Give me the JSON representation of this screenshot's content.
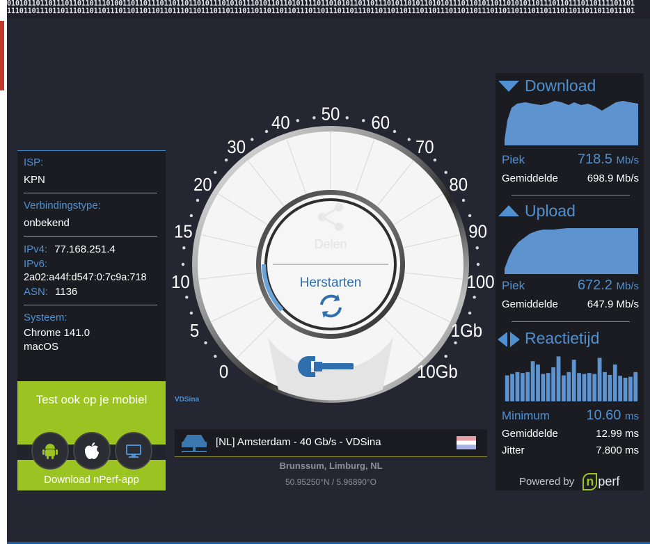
{
  "binary": {
    "line1": "01010110110111011011011101001101101110110110110101110101011101011011010111101101010110110111010110101101010111011010110110101011011101101110110111101101",
    "line2": "11101101110110111011011011101101101101101110110111011011101101101101101110110111011011101101101101110110111011011011101101101110110111011011011011011101"
  },
  "info": {
    "isp_label": "ISP:",
    "isp_value": "KPN",
    "conn_label": "Verbindingstype:",
    "conn_value": "onbekend",
    "ipv4_label": "IPv4:",
    "ipv4_value": "77.168.251.4",
    "ipv6_label": "IPv6:",
    "ipv6_value": "2a02:a44f:d547:0:7c9a:718",
    "asn_label": "ASN:",
    "asn_value": "1136",
    "system_label": "Systeem:",
    "browser_value": "Chrome 141.0",
    "os_value": "macOS"
  },
  "mobile": {
    "title": "Test ook op je mobiel",
    "download": "Download nPerf-app",
    "icons": [
      "android-icon",
      "apple-icon",
      "desktop-icon"
    ]
  },
  "gauge": {
    "labels": [
      "0",
      "5",
      "10",
      "15",
      "20",
      "30",
      "40",
      "50",
      "60",
      "70",
      "80",
      "90",
      "100",
      "1Gb",
      "10Gb"
    ],
    "share_label": "Delen",
    "restart_label": "Herstarten",
    "brand": "VDSina",
    "progress": 0.12
  },
  "server": {
    "name": "[NL] Amsterdam - 40 Gb/s - VDSina",
    "location": "Brunssum, Limburg, NL",
    "coords": "50.95250°N / 5.96890°O"
  },
  "download": {
    "title": "Download",
    "peak_label": "Piek",
    "peak_value": "718.5",
    "peak_unit": "Mb/s",
    "avg_label": "Gemiddelde",
    "avg_value": "698.9 Mb/s"
  },
  "upload": {
    "title": "Upload",
    "peak_label": "Piek",
    "peak_value": "672.2",
    "peak_unit": "Mb/s",
    "avg_label": "Gemiddelde",
    "avg_value": "647.9 Mb/s"
  },
  "latency": {
    "title": "Reactietijd",
    "min_label": "Minimum",
    "min_value": "10.60",
    "min_unit": "ms",
    "avg_label": "Gemiddelde",
    "avg_value": "12.99 ms",
    "jitter_label": "Jitter",
    "jitter_value": "7.800 ms"
  },
  "footer": {
    "powered_by": "Powered by",
    "brand": "nperf"
  },
  "colors": {
    "accent": "#4f90d0",
    "panel": "#1b1c22",
    "background": "#242632",
    "mobile": "#9bc423"
  }
}
